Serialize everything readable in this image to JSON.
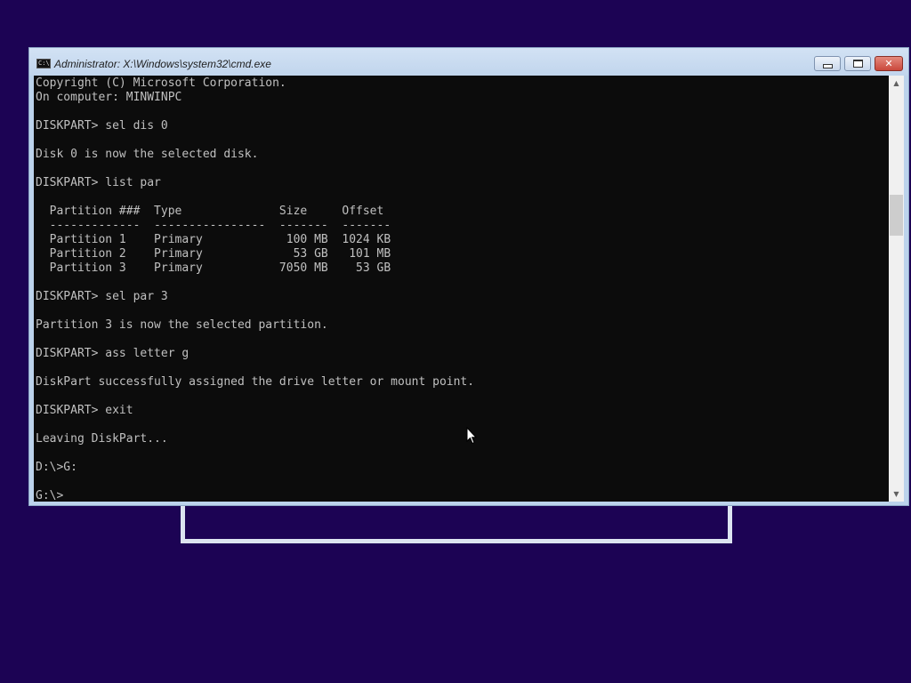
{
  "window": {
    "title": "Administrator: X:\\Windows\\system32\\cmd.exe",
    "icon": "cmd-icon",
    "controls": {
      "minimize_icon": "minimize-icon",
      "maximize_icon": "maximize-icon",
      "close_glyph": "✕"
    }
  },
  "console": {
    "lines": [
      "Copyright (C) Microsoft Corporation.",
      "On computer: MINWINPC",
      "",
      "DISKPART> sel dis 0",
      "",
      "Disk 0 is now the selected disk.",
      "",
      "DISKPART> list par",
      "",
      "  Partition ###  Type              Size     Offset",
      "  -------------  ----------------  -------  -------",
      "  Partition 1    Primary            100 MB  1024 KB",
      "  Partition 2    Primary             53 GB   101 MB",
      "  Partition 3    Primary           7050 MB    53 GB",
      "",
      "DISKPART> sel par 3",
      "",
      "Partition 3 is now the selected partition.",
      "",
      "DISKPART> ass letter g",
      "",
      "DiskPart successfully assigned the drive letter or mount point.",
      "",
      "DISKPART> exit",
      "",
      "Leaving DiskPart...",
      "",
      "D:\\>G:",
      "",
      "G:\\>"
    ]
  },
  "scrollbar": {
    "up_glyph": "▲",
    "down_glyph": "▼"
  },
  "colors": {
    "desktop": "#1c0354",
    "console_bg": "#0c0c0c",
    "console_fg": "#c0c0c0",
    "window_frame": "#bcd3ec"
  }
}
